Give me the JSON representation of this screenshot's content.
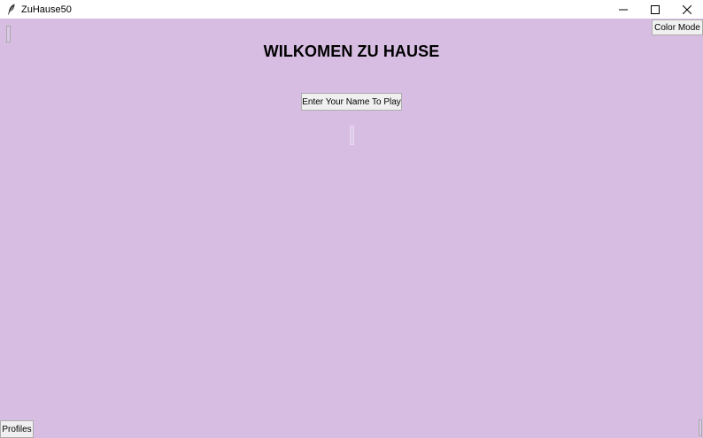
{
  "window": {
    "title": "ZuHause50",
    "minimize_glyph": "—",
    "maximize_glyph": "☐",
    "close_glyph": "✕",
    "background": "#d7bde2"
  },
  "toolbar": {
    "color_mode_label": "Color Mode"
  },
  "main": {
    "heading": "WILKOMEN ZU HAUSE",
    "play_button_label": "Enter Your Name To Play",
    "name_entry_value": ""
  },
  "footer": {
    "profiles_label": "Profiles"
  },
  "icons": {
    "app": "feather-icon"
  }
}
